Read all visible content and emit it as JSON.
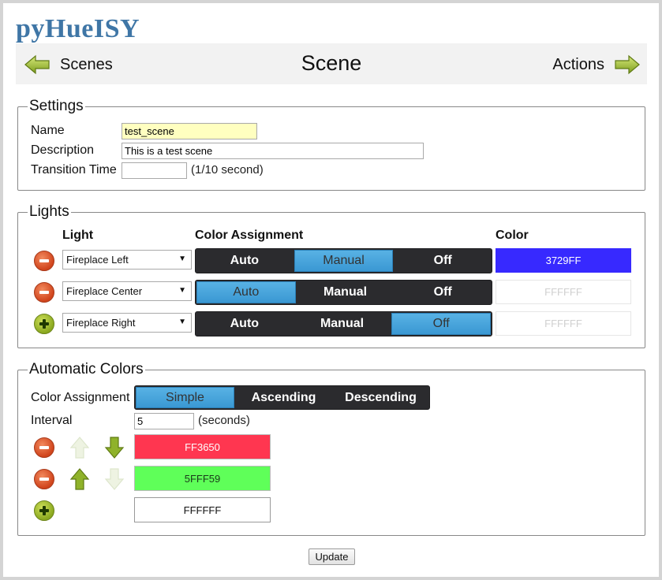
{
  "app": {
    "title": "pyHueISY"
  },
  "header": {
    "back_label": "Scenes",
    "title": "Scene",
    "forward_label": "Actions"
  },
  "settings": {
    "legend": "Settings",
    "name_label": "Name",
    "name_value": "test_scene",
    "description_label": "Description",
    "description_value": "This is a test scene",
    "transition_label": "Transition Time",
    "transition_value": "",
    "transition_suffix": "(1/10 second)"
  },
  "lights": {
    "legend": "Lights",
    "col_light": "Light",
    "col_assignment": "Color Assignment",
    "col_color": "Color",
    "assignment_options": [
      "Auto",
      "Manual",
      "Off"
    ],
    "rows": [
      {
        "light": "Fireplace Left",
        "action": "remove",
        "assignment": "Manual",
        "color": "3729FF",
        "color_hex": "#3729FF",
        "text_color": "#ffffff"
      },
      {
        "light": "Fireplace Center",
        "action": "remove",
        "assignment": "Auto",
        "color": "FFFFFF",
        "color_hex": "#FFFFFF",
        "text_color": "#d0d0d0"
      },
      {
        "light": "Fireplace Right",
        "action": "add",
        "assignment": "Off",
        "color": "FFFFFF",
        "color_hex": "#FFFFFF",
        "text_color": "#d0d0d0"
      }
    ]
  },
  "automatic": {
    "legend": "Automatic Colors",
    "assignment_label": "Color Assignment",
    "assignment_options": [
      "Simple",
      "Ascending",
      "Descending"
    ],
    "assignment_selected": "Simple",
    "interval_label": "Interval",
    "interval_value": "5",
    "interval_suffix": "(seconds)",
    "colors": [
      {
        "value": "FF3650",
        "hex": "#FF3650",
        "text_color": "#ffffff"
      },
      {
        "value": "5FFF59",
        "hex": "#5FFF59",
        "text_color": "#1a3a1a"
      },
      {
        "value": "FFFFFF",
        "hex": "#FFFFFF",
        "text_color": "#111111"
      }
    ]
  },
  "footer": {
    "update_label": "Update"
  },
  "colors": {
    "accent": "#3a98d3",
    "title": "#3f76a6",
    "segment_bg": "#2b2b2e"
  }
}
